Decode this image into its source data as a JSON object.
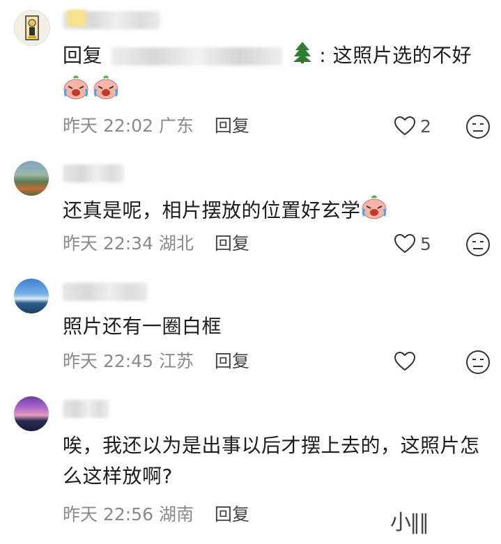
{
  "comments": [
    {
      "reply_prefix": "回复",
      "text": ": 这照片选的不好",
      "time": "昨天 22:02",
      "location": "广东",
      "reply_label": "回复",
      "likes": "2"
    },
    {
      "text": "还真是呢，相片摆放的位置好玄学",
      "time": "昨天 22:34",
      "location": "湖北",
      "reply_label": "回复",
      "likes": "5"
    },
    {
      "text": "照片还有一圈白框",
      "time": "昨天 22:45",
      "location": "江苏",
      "reply_label": "回复",
      "likes": ""
    },
    {
      "text": "唉，我还以为是出事以后才摆上去的，这照片怎么这样放啊?",
      "time": "昨天 22:56",
      "location": "湖南",
      "reply_label": "回复",
      "likes": ""
    }
  ],
  "watermark": "小∥∥",
  "icons": [
    "heart-icon",
    "neutral-face-icon",
    "crying-laughing-emoji",
    "tree-emoji"
  ]
}
